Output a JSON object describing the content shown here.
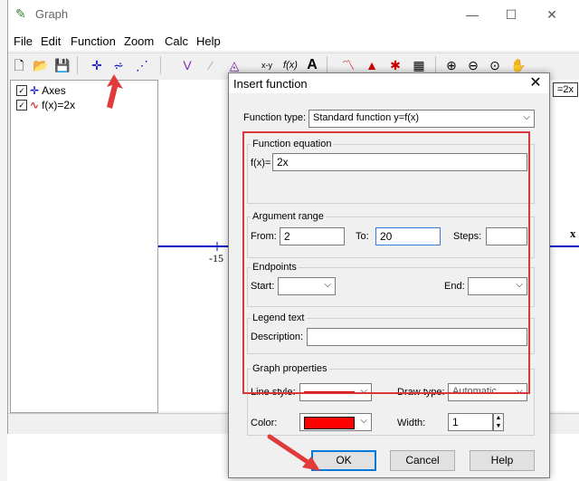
{
  "app": {
    "title": "Graph",
    "menu": [
      "File",
      "Edit",
      "Function",
      "Zoom",
      "Calc",
      "Help"
    ],
    "tree": [
      {
        "label": "Axes",
        "checked": true
      },
      {
        "label": "f(x)=2x",
        "checked": true
      }
    ],
    "axis_label": "-15",
    "x_axis_name": "x",
    "right_legend": "=2x"
  },
  "dialog": {
    "title": "Insert function",
    "function_type_label": "Function type:",
    "function_type_value": "Standard function   y=f(x)",
    "equation_group": "Function equation",
    "fx_label": "f(x)=",
    "fx_value": "2x",
    "argument_group": "Argument range",
    "from_label": "From:",
    "from_value": "2",
    "to_label": "To:",
    "to_value": "20",
    "steps_label": "Steps:",
    "steps_value": "",
    "endpoints_group": "Endpoints",
    "start_label": "Start:",
    "end_label": "End:",
    "legend_group": "Legend text",
    "description_label": "Description:",
    "description_value": "",
    "graph_props_group": "Graph properties",
    "line_style_label": "Line style:",
    "draw_type_label": "Draw type:",
    "draw_type_value": "Automatic",
    "color_label": "Color:",
    "color_value": "#ff0000",
    "width_label": "Width:",
    "width_value": "1",
    "ok_label": "OK",
    "cancel_label": "Cancel",
    "help_label": "Help"
  },
  "colors": {
    "annotation": "#e03a3a",
    "axis": "#0000c0",
    "curve": "#d00000"
  }
}
